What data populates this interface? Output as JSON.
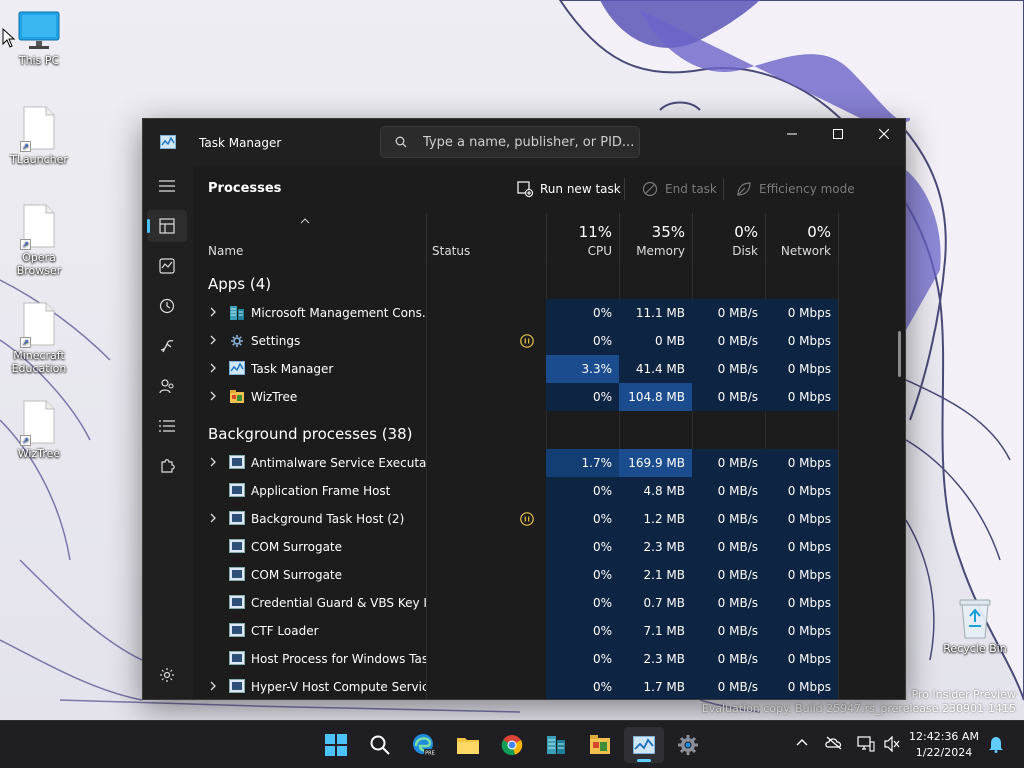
{
  "desktop": {
    "icons": [
      {
        "label": "This PC"
      },
      {
        "label": "TLauncher"
      },
      {
        "label": "Opera Browser"
      },
      {
        "label": "Minecraft Education"
      },
      {
        "label": "WizTree"
      },
      {
        "label": "Recycle Bin"
      }
    ],
    "watermark_line1": "11 Pro Insider Preview",
    "watermark_line2": "Evaluation copy. Build 25947.rs_prerelease.230901-1415"
  },
  "taskmanager": {
    "title": "Task Manager",
    "search_placeholder": "Type a name, publisher, or PID...",
    "page_title": "Processes",
    "toolbar": {
      "run_new_task": "Run new task",
      "end_task": "End task",
      "efficiency_mode": "Efficiency mode"
    },
    "columns": {
      "name": "Name",
      "status": "Status",
      "cpu_pct": "11%",
      "cpu": "CPU",
      "mem_pct": "35%",
      "mem": "Memory",
      "disk_pct": "0%",
      "disk": "Disk",
      "net_pct": "0%",
      "net": "Network"
    },
    "groups": {
      "apps": "Apps (4)",
      "background": "Background processes (38)"
    },
    "apps": [
      {
        "name": "Microsoft Management Cons...",
        "cpu": "0%",
        "mem": "11.1 MB",
        "disk": "0 MB/s",
        "net": "0 Mbps"
      },
      {
        "name": "Settings",
        "cpu": "0%",
        "mem": "0 MB",
        "disk": "0 MB/s",
        "net": "0 Mbps"
      },
      {
        "name": "Task Manager",
        "cpu": "3.3%",
        "mem": "41.4 MB",
        "disk": "0 MB/s",
        "net": "0 Mbps"
      },
      {
        "name": "WizTree",
        "cpu": "0%",
        "mem": "104.8 MB",
        "disk": "0 MB/s",
        "net": "0 Mbps"
      }
    ],
    "background": [
      {
        "name": "Antimalware Service Executable",
        "cpu": "1.7%",
        "mem": "169.9 MB",
        "disk": "0 MB/s",
        "net": "0 Mbps"
      },
      {
        "name": "Application Frame Host",
        "cpu": "0%",
        "mem": "4.8 MB",
        "disk": "0 MB/s",
        "net": "0 Mbps"
      },
      {
        "name": "Background Task Host (2)",
        "cpu": "0%",
        "mem": "1.2 MB",
        "disk": "0 MB/s",
        "net": "0 Mbps"
      },
      {
        "name": "COM Surrogate",
        "cpu": "0%",
        "mem": "2.3 MB",
        "disk": "0 MB/s",
        "net": "0 Mbps"
      },
      {
        "name": "COM Surrogate",
        "cpu": "0%",
        "mem": "2.1 MB",
        "disk": "0 MB/s",
        "net": "0 Mbps"
      },
      {
        "name": "Credential Guard & VBS Key Is...",
        "cpu": "0%",
        "mem": "0.7 MB",
        "disk": "0 MB/s",
        "net": "0 Mbps"
      },
      {
        "name": "CTF Loader",
        "cpu": "0%",
        "mem": "7.1 MB",
        "disk": "0 MB/s",
        "net": "0 Mbps"
      },
      {
        "name": "Host Process for Windows Tasks",
        "cpu": "0%",
        "mem": "2.3 MB",
        "disk": "0 MB/s",
        "net": "0 Mbps"
      },
      {
        "name": "Hyper-V Host Compute Service",
        "cpu": "0%",
        "mem": "1.7 MB",
        "disk": "0 MB/s",
        "net": "0 Mbps"
      }
    ]
  },
  "taskbar": {
    "time": "12:42:36 AM",
    "date": "1/22/2024"
  },
  "colors": {
    "accent": "#4cc2ff",
    "heat_low": "#0d2542",
    "heat_mid": "#133e73",
    "heat_high": "#1b4d8e",
    "suspended": "#e8c547"
  }
}
